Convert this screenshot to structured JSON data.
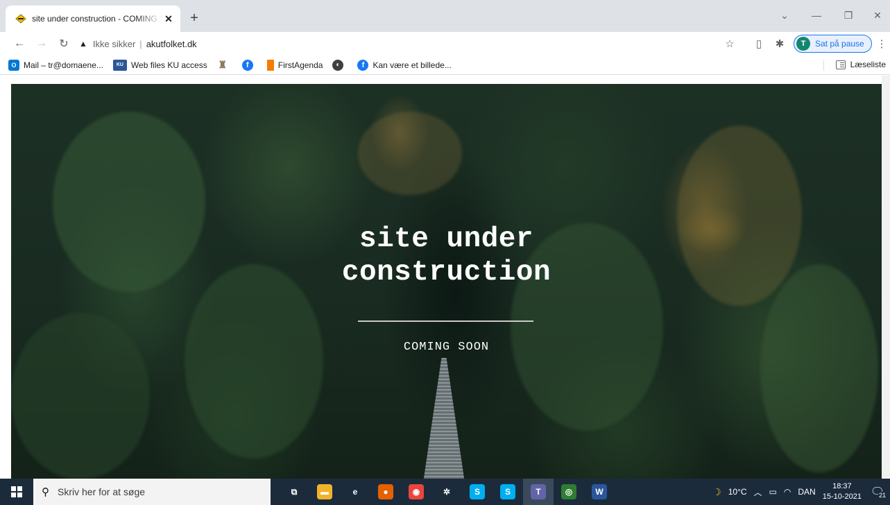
{
  "browser": {
    "tab": {
      "title": "site under construction - COMING SOON"
    },
    "address": {
      "security_label": "Ikke sikker",
      "separator": "|",
      "url": "akutfolket.dk"
    },
    "profile": {
      "initial": "T",
      "label": "Sat på pause"
    },
    "bookmarks": [
      {
        "label": "Mail – tr@domaene...",
        "icon": "outlook-icon",
        "color": "#0078d4"
      },
      {
        "label": "Web files KU access",
        "icon": "ku-icon",
        "color": "#2b5797"
      },
      {
        "label": "",
        "icon": "seal-icon",
        "color": "#8a7a5a"
      },
      {
        "label": "",
        "icon": "facebook-icon",
        "color": "#1877f2"
      },
      {
        "label": "FirstAgenda",
        "icon": "bookmark-icon",
        "color": "#f57c00"
      },
      {
        "label": "",
        "icon": "globe-icon",
        "color": "#5f6368"
      },
      {
        "label": "Kan være et billede...",
        "icon": "facebook-icon",
        "color": "#1877f2"
      }
    ],
    "reading_list": "Læseliste"
  },
  "page": {
    "headline_line1": "site under",
    "headline_line2": "construction",
    "tagline": "COMING SOON"
  },
  "taskbar": {
    "search_placeholder": "Skriv her for at søge",
    "apps": [
      {
        "name": "task-view-icon",
        "color": "#1c2b3c",
        "glyph": "⧉"
      },
      {
        "name": "file-explorer-icon",
        "color": "#f0b429",
        "glyph": "▬"
      },
      {
        "name": "edge-legacy-icon",
        "color": "#1c2b3c",
        "glyph": "e"
      },
      {
        "name": "firefox-icon",
        "color": "#e66000",
        "glyph": "●"
      },
      {
        "name": "chrome-icon",
        "color": "#e8453c",
        "glyph": "◉"
      },
      {
        "name": "settings-icon",
        "color": "#1c2b3c",
        "glyph": "✲"
      },
      {
        "name": "skype-icon",
        "color": "#00aff0",
        "glyph": "S"
      },
      {
        "name": "skype-business-icon",
        "color": "#00aff0",
        "glyph": "S"
      },
      {
        "name": "teams-icon",
        "color": "#6264a7",
        "glyph": "T"
      },
      {
        "name": "globe-app-icon",
        "color": "#2e7d32",
        "glyph": "◎"
      },
      {
        "name": "word-icon",
        "color": "#2b579a",
        "glyph": "W"
      }
    ],
    "weather": "10°C",
    "language": "DAN",
    "time": "18:37",
    "date": "15-10-2021",
    "notifications": "21"
  }
}
